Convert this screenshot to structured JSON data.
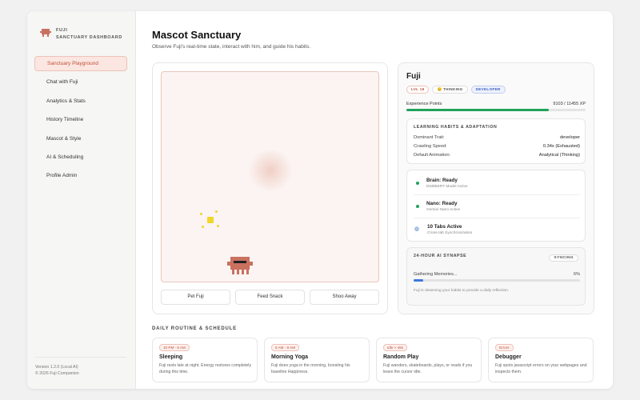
{
  "brand": {
    "line1": "FUJI",
    "line2": "SANCTUARY DASHBOARD"
  },
  "nav": [
    {
      "label": "Sanctuary Playground",
      "active": true
    },
    {
      "label": "Chat with Fuji"
    },
    {
      "label": "Analytics & Stats"
    },
    {
      "label": "History Timeline"
    },
    {
      "label": "Mascot & Style"
    },
    {
      "label": "AI & Scheduling"
    },
    {
      "label": "Profile Admin"
    }
  ],
  "footer": {
    "version": "Version 1.2.0 (Local AI)",
    "copyright": "© 2026 Fuji Companion"
  },
  "page": {
    "title": "Mascot Sanctuary",
    "subtitle": "Observe Fuji's real-time state, interact with him, and guide his habits."
  },
  "actions": {
    "pet": "Pet Fuji",
    "feed": "Feed Snack",
    "shoo": "Shoo Away"
  },
  "profile": {
    "name": "Fuji",
    "badges": {
      "level": "LVL 19",
      "state": "😐 THINKING",
      "role": "DEVELOPER"
    },
    "xp_label": "Experience Points",
    "xp_value": "9103 / 11455 XP",
    "xp_fraction": 0.795
  },
  "habits": {
    "title": "LEARNING HABITS & ADAPTATION",
    "rows": [
      {
        "k": "Dominant Trait:",
        "v": "developer"
      },
      {
        "k": "Crawling Speed:",
        "v": "0.34x (Exhausted)"
      },
      {
        "k": "Default Animation:",
        "v": "Analytical (Thinking)"
      }
    ]
  },
  "status": [
    {
      "title": "Brain: Ready",
      "sub": "DistilBERT Model Active"
    },
    {
      "title": "Nano: Ready",
      "sub": "Gemini Nano Active"
    },
    {
      "title": "10 Tabs Active",
      "sub": "Cross-tab Synchronization"
    }
  ],
  "synapse": {
    "title": "24-HOUR AI SYNAPSE",
    "badge": "SYNCING",
    "label": "Gathering Memories...",
    "percent": "6%",
    "fraction": 0.06,
    "note": "Fuji is observing your habits to provide a daily reflection."
  },
  "routine": {
    "title": "DAILY ROUTINE & SCHEDULE",
    "cards": [
      {
        "tag": "10 PM - 6 AM",
        "title": "Sleeping",
        "desc": "Fuji rests late at night. Energy restores completely during this time."
      },
      {
        "tag": "6 AM - 9 AM",
        "title": "Morning Yoga",
        "desc": "Fuji does yoga in the morning, boosting his baseline Happiness."
      },
      {
        "tag": "Idle > 45s",
        "title": "Random Play",
        "desc": "Fuji wanders, skateboards, plays, or reads if you leave the cursor idle."
      },
      {
        "tag": "Errors",
        "title": "Debugger",
        "desc": "Fuji spots javascript errors on your webpages and inspects them."
      }
    ]
  },
  "colors": {
    "accent": "#c0513b",
    "success": "#1fa35a",
    "info": "#3b78e0",
    "mascot": "#c9715f"
  }
}
